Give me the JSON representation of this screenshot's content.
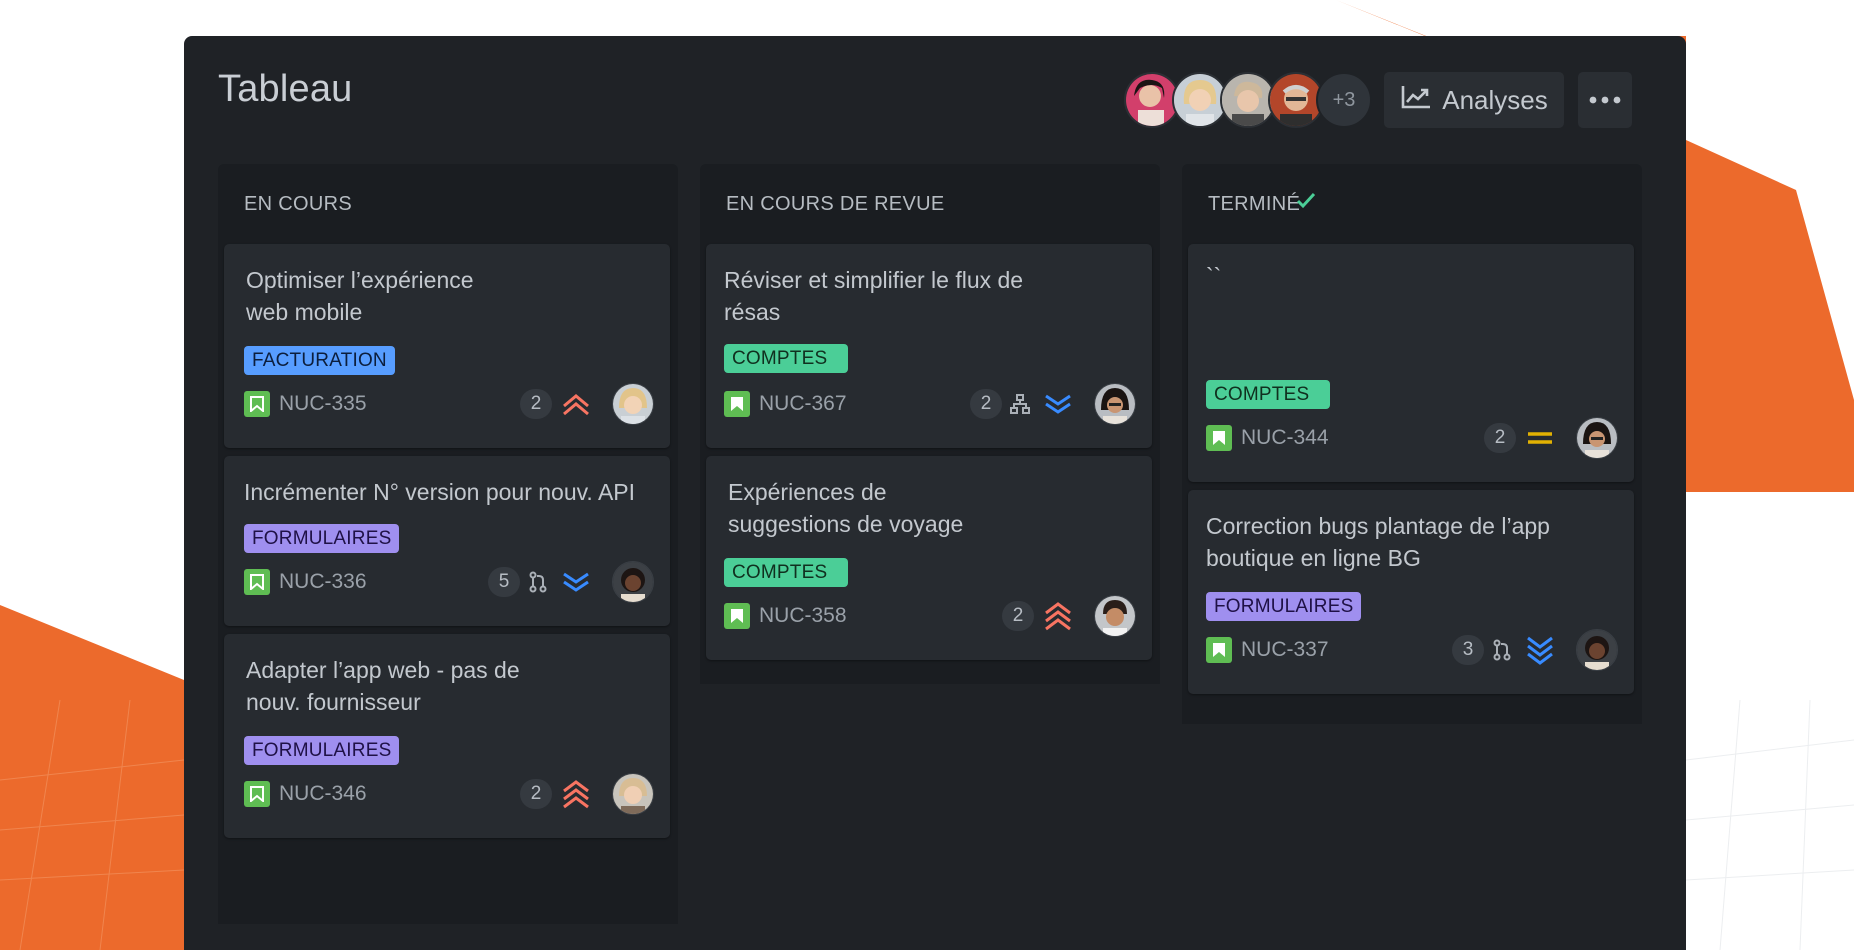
{
  "board": {
    "title": "Tableau",
    "extra_members": "+3",
    "analytics_label": "Analyses",
    "more_icon": "more-horizontal-icon"
  },
  "colors": {
    "accent_orange": "#ec6a2c",
    "board_bg": "#1f2226",
    "card_bg": "#272b30"
  },
  "columns": [
    {
      "title": "EN COURS",
      "cards": [
        {
          "title": "Optimiser l’expérience web mobile",
          "tag": "FACTURATION",
          "key": "NUC-335",
          "count": "2",
          "priority": "high"
        },
        {
          "title": "Incrémenter N° version pour nouv. API",
          "tag": "FORMULAIRES",
          "key": "NUC-336",
          "count": "5",
          "priority": "low"
        },
        {
          "title": "Adapter l’app web - pas de nouv. fournisseur",
          "tag": "FORMULAIRES",
          "key": "NUC-346",
          "count": "2",
          "priority": "highest"
        }
      ]
    },
    {
      "title": "EN COURS DE REVUE",
      "cards": [
        {
          "title": "Réviser et simplifier le flux de résas",
          "tag": "COMPTES",
          "key": "NUC-367",
          "count": "2",
          "priority": "low"
        },
        {
          "title": "Expériences de suggestions de voyage",
          "tag": "COMPTES",
          "key": "NUC-358",
          "count": "2",
          "priority": "highest"
        }
      ]
    },
    {
      "title": "TERMINÉ",
      "cards": [
        {
          "title": "``",
          "tag": "COMPTES",
          "key": "NUC-344",
          "count": "2",
          "priority": "medium"
        },
        {
          "title": "Correction bugs plantage de l’app boutique en ligne BG",
          "tag": "FORMULAIRES",
          "key": "NUC-337",
          "count": "3",
          "priority": "lowest"
        }
      ]
    }
  ]
}
